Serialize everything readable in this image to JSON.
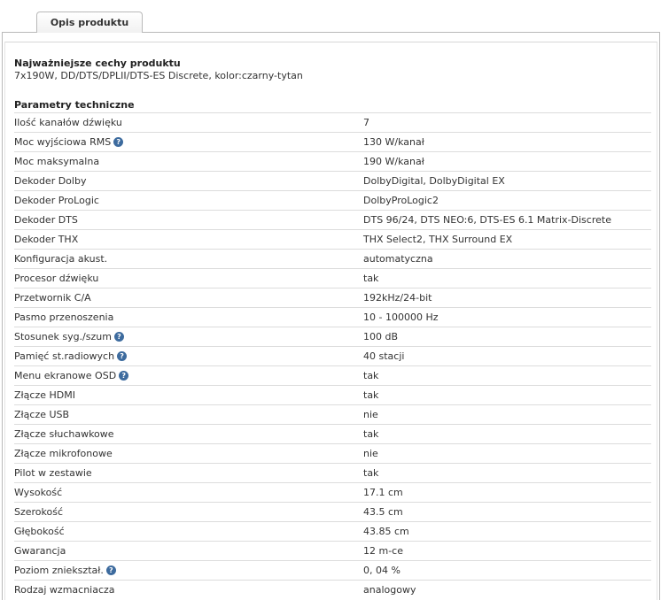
{
  "tab": {
    "label": "Opis produktu"
  },
  "features": {
    "title": "Najważniejsze cechy produktu",
    "description": "7x190W, DD/DTS/DPLII/DTS-ES Discrete, kolor:czarny-tytan"
  },
  "params": {
    "title": "Parametry techniczne",
    "rows": [
      {
        "label": "Ilość kanałów dźwięku",
        "value": "7",
        "help": false
      },
      {
        "label": "Moc wyjściowa RMS",
        "value": "130 W/kanał",
        "help": true
      },
      {
        "label": "Moc maksymalna",
        "value": "190 W/kanał",
        "help": false
      },
      {
        "label": "Dekoder Dolby",
        "value": "DolbyDigital, DolbyDigital EX",
        "help": false
      },
      {
        "label": "Dekoder ProLogic",
        "value": "DolbyProLogic2",
        "help": false
      },
      {
        "label": "Dekoder DTS",
        "value": "DTS 96/24, DTS NEO:6, DTS-ES 6.1 Matrix-Discrete",
        "help": false
      },
      {
        "label": "Dekoder THX",
        "value": "THX Select2, THX Surround EX",
        "help": false
      },
      {
        "label": "Konfiguracja akust.",
        "value": "automatyczna",
        "help": false
      },
      {
        "label": "Procesor dźwięku",
        "value": "tak",
        "help": false
      },
      {
        "label": "Przetwornik C/A",
        "value": "192kHz/24-bit",
        "help": false
      },
      {
        "label": "Pasmo przenoszenia",
        "value": "10 - 100000 Hz",
        "help": false
      },
      {
        "label": "Stosunek syg./szum",
        "value": "100 dB",
        "help": true
      },
      {
        "label": "Pamięć st.radiowych",
        "value": "40 stacji",
        "help": true
      },
      {
        "label": "Menu ekranowe OSD",
        "value": "tak",
        "help": true
      },
      {
        "label": "Złącze HDMI",
        "value": "tak",
        "help": false
      },
      {
        "label": "Złącze USB",
        "value": "nie",
        "help": false
      },
      {
        "label": "Złącze słuchawkowe",
        "value": "tak",
        "help": false
      },
      {
        "label": "Złącze mikrofonowe",
        "value": "nie",
        "help": false
      },
      {
        "label": "Pilot w zestawie",
        "value": "tak",
        "help": false
      },
      {
        "label": "Wysokość",
        "value": "17.1 cm",
        "help": false
      },
      {
        "label": "Szerokość",
        "value": "43.5 cm",
        "help": false
      },
      {
        "label": "Głębokość",
        "value": "43.85 cm",
        "help": false
      },
      {
        "label": "Gwarancja",
        "value": "12 m-ce",
        "help": false
      },
      {
        "label": "Poziom zniekształ.",
        "value": "0, 04 %",
        "help": true
      },
      {
        "label": "Rodzaj wzmacniacza",
        "value": "analogowy",
        "help": false
      }
    ]
  },
  "icons": {
    "help": "question-mark-icon",
    "help_glyph": "?"
  },
  "colors": {
    "help_icon": "#3d6b9e",
    "row_border": "#dcdcdc"
  }
}
